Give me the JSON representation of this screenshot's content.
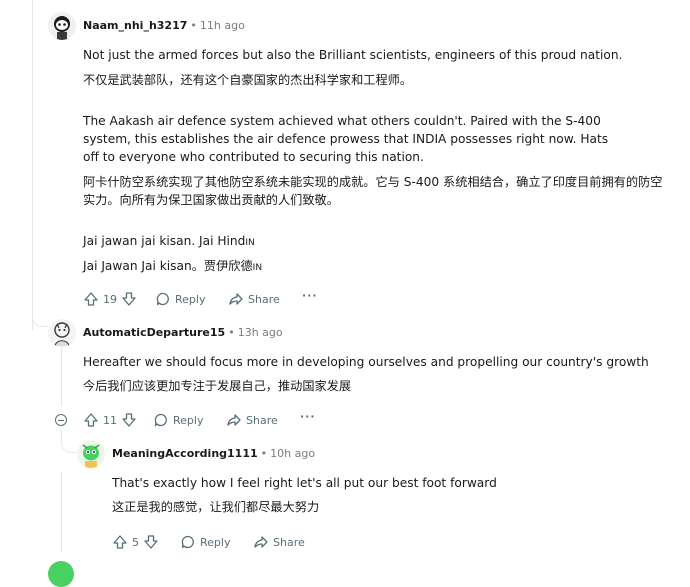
{
  "comments": [
    {
      "username": "Naam_nhi_h3217",
      "time": "11h ago",
      "paragraphs": [
        "Not just the armed forces but also the Brilliant scientists, engineers of this proud nation.",
        "不仅是武装部队，还有这个自豪国家的杰出科学家和工程师。",
        "The Aakash air defence system achieved what others couldn't. Paired with the S-400 system, this establishes the air defence prowess that INDIA possesses right now. Hats off to everyone who contributed to securing this nation.",
        "阿卡什防空系统实现了其他防空系统未能实现的成就。它与 S-400 系统相结合，确立了印度目前拥有的防空实力。向所有为保卫国家做出贡献的人们致敬。",
        "Jai jawan jai kisan. Jai Hind",
        "Jai Jawan Jai kisan。贾伊欣德"
      ],
      "flag_text": "IN",
      "votes": "19",
      "reply_label": "Reply",
      "share_label": "Share",
      "more_label": "···"
    },
    {
      "username": "AutomaticDeparture15",
      "time": "13h ago",
      "paragraphs": [
        "Hereafter we should focus more in developing ourselves and propelling our country's growth",
        "今后我们应该更加专注于发展自己，推动国家发展"
      ],
      "votes": "11",
      "reply_label": "Reply",
      "share_label": "Share",
      "more_label": "···"
    },
    {
      "username": "MeaningAccording1111",
      "time": "10h ago",
      "paragraphs": [
        "That's exactly how I feel right let's all put our best foot forward",
        "这正是我的感觉，让我们都尽最大努力"
      ],
      "votes": "5",
      "reply_label": "Reply",
      "share_label": "Share"
    }
  ],
  "separator": "•",
  "colors": {
    "text": "#1a1a1b",
    "meta": "#7c7c7c",
    "action": "#576f76",
    "thread": "#e5e7ea",
    "avatar_green": "#46d160"
  }
}
